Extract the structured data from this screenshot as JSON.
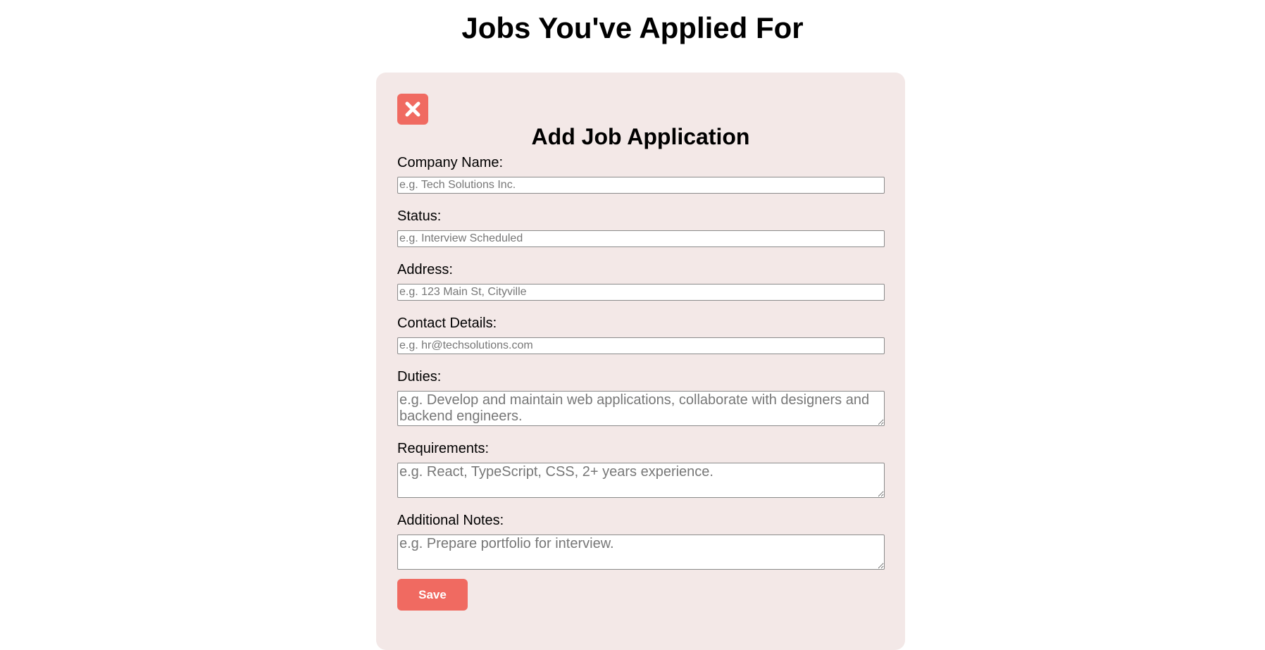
{
  "page": {
    "title": "Jobs You've Applied For"
  },
  "form": {
    "title": "Add Job Application",
    "close_icon": "close-icon",
    "fields": {
      "company_name": {
        "label": "Company Name:",
        "placeholder": "e.g. Tech Solutions Inc.",
        "value": ""
      },
      "status": {
        "label": "Status:",
        "placeholder": "e.g. Interview Scheduled",
        "value": ""
      },
      "address": {
        "label": "Address:",
        "placeholder": "e.g. 123 Main St, Cityville",
        "value": ""
      },
      "contact_details": {
        "label": "Contact Details:",
        "placeholder": "e.g. hr@techsolutions.com",
        "value": ""
      },
      "duties": {
        "label": "Duties:",
        "placeholder": "e.g. Develop and maintain web applications, collaborate with designers and backend engineers.",
        "value": ""
      },
      "requirements": {
        "label": "Requirements:",
        "placeholder": "e.g. React, TypeScript, CSS, 2+ years experience.",
        "value": ""
      },
      "additional_notes": {
        "label": "Additional Notes:",
        "placeholder": "e.g. Prepare portfolio for interview.",
        "value": ""
      }
    },
    "save_label": "Save"
  },
  "colors": {
    "accent": "#f06a61",
    "card_background": "#f3e8e7"
  }
}
